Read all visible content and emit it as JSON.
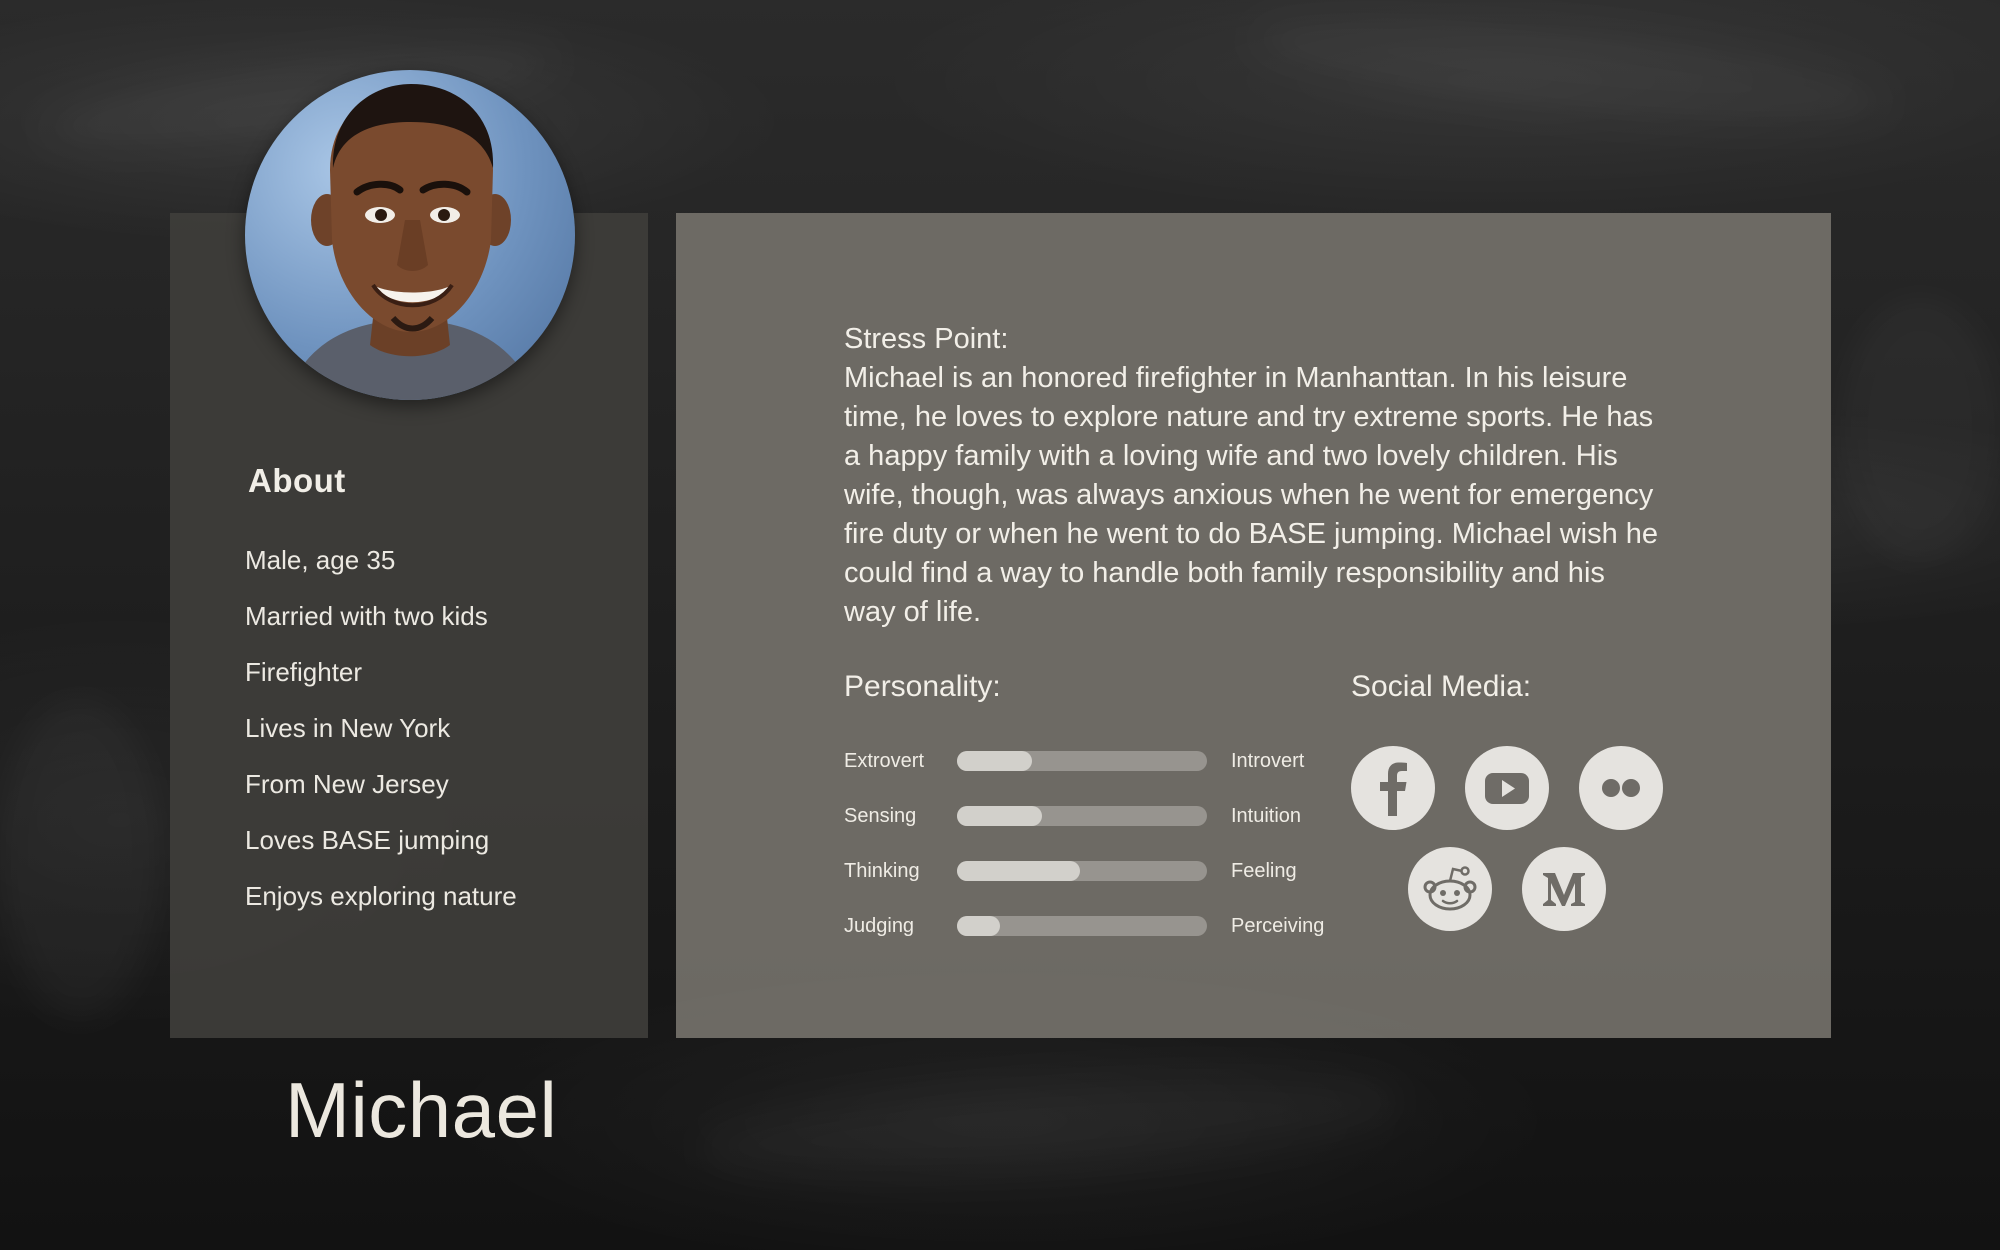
{
  "persona": {
    "name": "Michael",
    "photo_alt": "Portrait of Michael"
  },
  "about": {
    "title": "About",
    "items": [
      "Male, age 35",
      "Married with two kids",
      "Firefighter",
      "Lives in New York",
      "From New Jersey",
      "Loves BASE jumping",
      "Enjoys exploring nature"
    ]
  },
  "stress_point": {
    "label": "Stress Point:",
    "text": "Michael is an honored firefighter in Manhanttan. In his leisure time, he loves to explore nature and try extreme sports. He has a happy family with a loving wife and two lovely children. His wife, though, was always anxious when he went for emergency fire duty or when he went to do BASE jumping. Michael wish he could find a way to handle both family responsibility and his way of life."
  },
  "personality": {
    "title": "Personality:",
    "traits": [
      {
        "left": "Extrovert",
        "right": "Introvert",
        "value": 0.3
      },
      {
        "left": "Sensing",
        "right": "Intuition",
        "value": 0.34
      },
      {
        "left": "Thinking",
        "right": "Feeling",
        "value": 0.49
      },
      {
        "left": "Judging",
        "right": "Perceiving",
        "value": 0.17
      }
    ]
  },
  "social_media": {
    "title": "Social Media:",
    "icons": [
      "facebook-icon",
      "youtube-icon",
      "flickr-icon",
      "reddit-icon",
      "medium-icon"
    ]
  },
  "colors": {
    "icon_bg": "#e5e3df",
    "icon_fg": "#6f6c67",
    "bar_track": "#97948f",
    "bar_fill": "#d2d0cb"
  }
}
